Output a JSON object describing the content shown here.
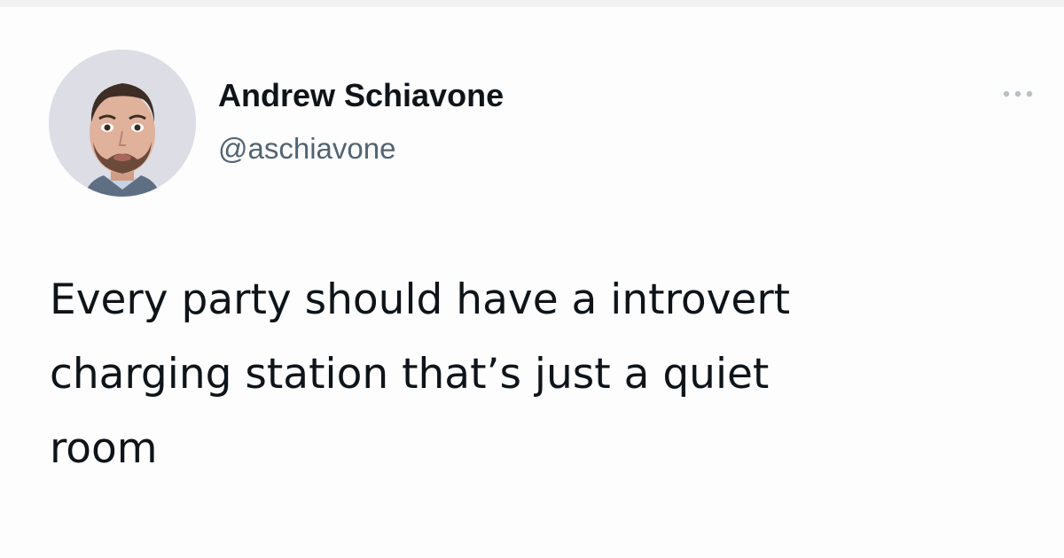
{
  "tweet": {
    "author": {
      "display_name": "Andrew Schiavone",
      "handle": "@aschiavone",
      "avatar_icon": "profile-photo"
    },
    "more_icon": "more-horizontal-icon",
    "text": "Every party should have a introvert\ncharging station that’s just a quiet\nroom"
  },
  "colors": {
    "primary_text": "#0f1419",
    "secondary_text": "#536471",
    "background": "#fdfdfd",
    "more_icon": "#b9c0c6"
  }
}
